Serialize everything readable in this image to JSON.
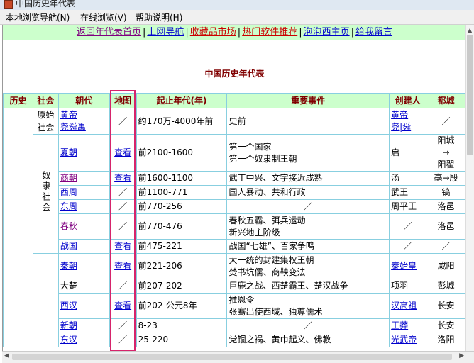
{
  "window": {
    "title": "中国历史年代表"
  },
  "menu": [
    "本地浏览导航(N)",
    "在线浏览(V)",
    "帮助说明(H)"
  ],
  "nav": [
    {
      "label": "返回年代表首页",
      "color": "#800080"
    },
    {
      "label": "上网导航",
      "color": "#0000cc"
    },
    {
      "label": "收藏品市场",
      "color": "#cc0000"
    },
    {
      "label": "热门软件推荐",
      "color": "#cc0000"
    },
    {
      "label": "泡泡西主页",
      "color": "#0000cc"
    },
    {
      "label": "给我留言",
      "color": "#0000cc"
    }
  ],
  "nav_separator": "|",
  "page_title": "中国历史年代表",
  "headers": [
    "历史",
    "社会",
    "朝代",
    "地图",
    "起止年代(年)",
    "重要事件",
    "创建人",
    "都城"
  ],
  "society": {
    "primitive": "原始社会",
    "slave": "奴隶社会"
  },
  "view_label": "查看",
  "rows": [
    {
      "dynasty": [
        "黄帝",
        "尧舜禹"
      ],
      "dyn_link": "lk",
      "map": "／",
      "period": "约170万-4000年前",
      "events": [
        "史前"
      ],
      "events_center": false,
      "founder": [
        "黄帝",
        "尧|舜"
      ],
      "founder_link": true,
      "capital": [
        "／"
      ]
    },
    {
      "dynasty": [
        "夏朝"
      ],
      "dyn_link": "lk",
      "map": "view",
      "period": "前2100-1600",
      "events": [
        "第一个国家",
        "第一个奴隶制王朝"
      ],
      "events_center": false,
      "founder": [
        "启"
      ],
      "founder_link": false,
      "capital": [
        "阳城",
        "→",
        "阳翟"
      ]
    },
    {
      "dynasty": [
        "商朝"
      ],
      "dyn_link": "lkv",
      "map": "view",
      "period": "前1600-1100",
      "events": [
        "武丁中兴、文字接近成熟"
      ],
      "events_center": false,
      "founder": [
        "汤"
      ],
      "founder_link": false,
      "capital": [
        "亳→殷"
      ]
    },
    {
      "dynasty": [
        "西周"
      ],
      "dyn_link": "lk",
      "map": "／",
      "period": "前1100-771",
      "events": [
        "国人暴动、共和行政"
      ],
      "events_center": false,
      "founder": [
        "武王"
      ],
      "founder_link": false,
      "capital": [
        "镐"
      ]
    },
    {
      "dynasty": [
        "东周"
      ],
      "dyn_link": "lk",
      "map": "／",
      "period": "前770-256",
      "events": [
        "／"
      ],
      "events_center": true,
      "founder": [
        "周平王"
      ],
      "founder_link": false,
      "capital": [
        "洛邑"
      ]
    },
    {
      "dynasty": [
        "春秋"
      ],
      "dyn_link": "lkv",
      "map": "／",
      "period": "前770-476",
      "events": [
        "春秋五霸、弭兵运动",
        "新兴地主阶级"
      ],
      "events_center": false,
      "founder": [
        "／"
      ],
      "founder_link": false,
      "capital": [
        "洛邑"
      ]
    },
    {
      "dynasty": [
        "战国"
      ],
      "dyn_link": "lk",
      "map": "view",
      "period": "前475-221",
      "events": [
        "战国“七雄”、百家争鸣"
      ],
      "events_center": false,
      "founder": [
        "／"
      ],
      "founder_link": false,
      "capital": [
        "／"
      ]
    },
    {
      "dynasty": [
        "秦朝"
      ],
      "dyn_link": "lk",
      "map": "view",
      "period": "前221-206",
      "events": [
        "大一统的封建集权王朝",
        "焚书坑儒、商鞅变法"
      ],
      "events_center": false,
      "founder": [
        "秦始皇"
      ],
      "founder_link": true,
      "capital": [
        "咸阳"
      ]
    },
    {
      "dynasty": [
        "大楚"
      ],
      "dyn_link": "",
      "map": "／",
      "period": "前207-202",
      "events": [
        "巨鹿之战、西楚霸王、楚汉战争"
      ],
      "events_center": false,
      "founder": [
        "项羽"
      ],
      "founder_link": false,
      "capital": [
        "彭城"
      ]
    },
    {
      "dynasty": [
        "西汉"
      ],
      "dyn_link": "lk",
      "map": "view",
      "period": "前202-公元8年",
      "events": [
        "推恩令",
        "张骞出使西域、独尊儒术"
      ],
      "events_center": false,
      "founder": [
        "汉高祖"
      ],
      "founder_link": true,
      "capital": [
        "长安"
      ]
    },
    {
      "dynasty": [
        "新朝"
      ],
      "dyn_link": "lk",
      "map": "／",
      "period": "8-23",
      "events": [
        "／"
      ],
      "events_center": true,
      "founder": [
        "王莽"
      ],
      "founder_link": true,
      "capital": [
        "长安"
      ]
    },
    {
      "dynasty": [
        "东汉"
      ],
      "dyn_link": "lk",
      "map": "／",
      "period": "25-220",
      "events": [
        "党锢之祸、黄巾起义、佛教"
      ],
      "events_center": false,
      "founder": [
        "光武帝"
      ],
      "founder_link": true,
      "capital": [
        "洛阳"
      ]
    }
  ]
}
